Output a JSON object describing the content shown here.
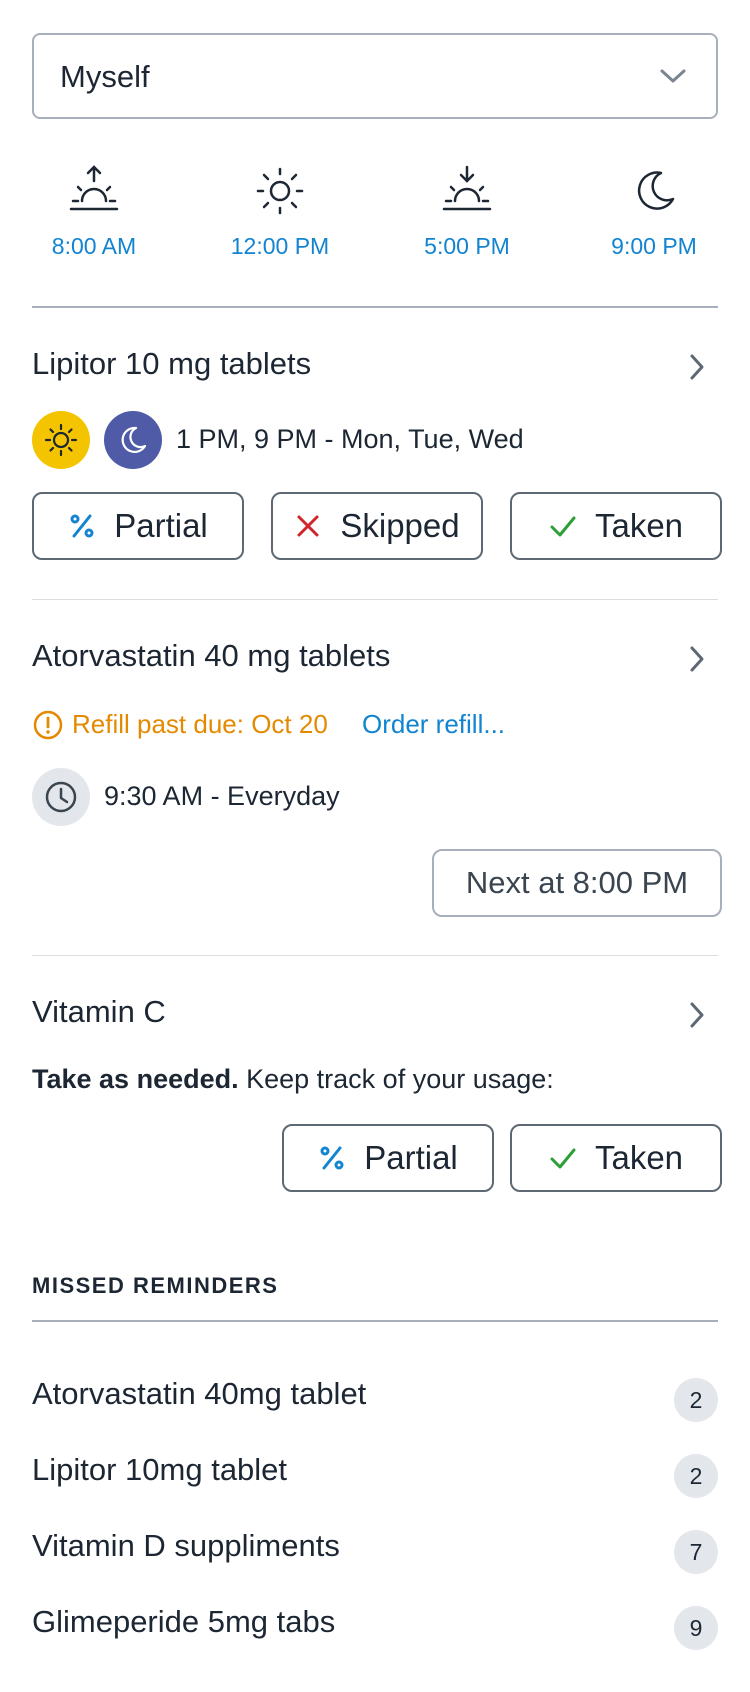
{
  "selector": {
    "value": "Myself"
  },
  "times_of_day": [
    {
      "icon": "sunrise-icon",
      "label": "8:00 AM"
    },
    {
      "icon": "sun-icon",
      "label": "12:00 PM"
    },
    {
      "icon": "sunset-icon",
      "label": "5:00 PM"
    },
    {
      "icon": "moon-icon",
      "label": "9:00 PM"
    }
  ],
  "medications": [
    {
      "name": "Lipitor 10 mg tablets",
      "schedule": "1 PM, 9 PM - Mon, Tue, Wed",
      "actions": {
        "partial": "Partial",
        "skipped": "Skipped",
        "taken": "Taken"
      }
    },
    {
      "name": "Atorvastatin 40 mg tablets",
      "refill_warning": "Refill past due: Oct 20",
      "refill_link": "Order refill...",
      "schedule": "9:30 AM - Everyday",
      "next_label": "Next at 8:00 PM"
    },
    {
      "name": "Vitamin C",
      "note_bold": "Take as needed.",
      "note_rest": " Keep track of your usage:",
      "actions": {
        "partial": "Partial",
        "taken": "Taken"
      }
    }
  ],
  "missed": {
    "heading": "MISSED REMINDERS",
    "items": [
      {
        "name": "Atorvastatin 40mg tablet",
        "count": "2"
      },
      {
        "name": "Lipitor 10mg tablet",
        "count": "2"
      },
      {
        "name": "Vitamin D suppliments",
        "count": "7"
      },
      {
        "name": "Glimeperide 5mg tabs",
        "count": "9"
      }
    ]
  },
  "colors": {
    "accent_blue": "#1284d1",
    "warning_orange": "#e48a00",
    "sun_badge": "#f5c400",
    "moon_badge": "#4f5ba6",
    "check_green": "#2e9e36",
    "skip_red": "#d0262b"
  }
}
